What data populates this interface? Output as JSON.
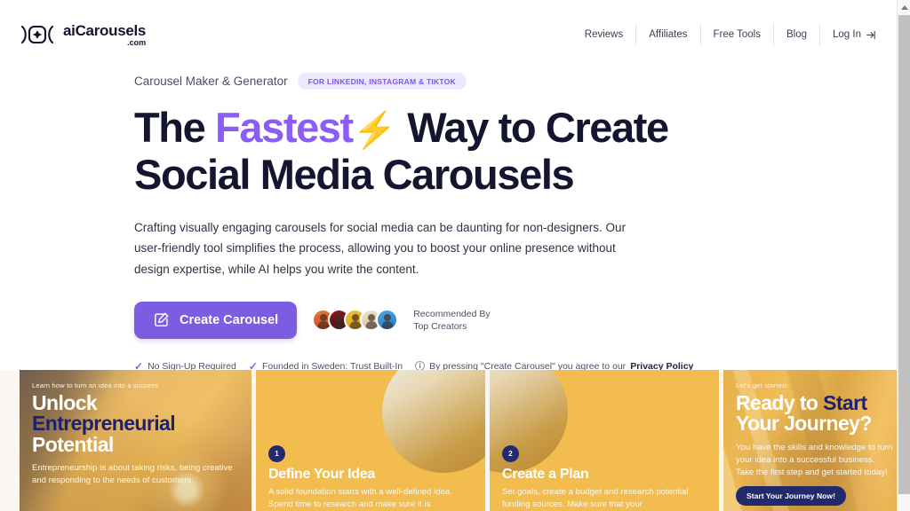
{
  "brand": {
    "logo_icon": "bracket-diamond-logo-icon",
    "name": "aiCarousels",
    "domain_suffix": ".com"
  },
  "nav": {
    "items": [
      {
        "label": "Reviews"
      },
      {
        "label": "Affiliates"
      },
      {
        "label": "Free Tools"
      },
      {
        "label": "Blog"
      }
    ],
    "login": {
      "label": "Log In",
      "icon": "login-arrow-icon"
    }
  },
  "hero": {
    "eyebrow": "Carousel Maker & Generator",
    "badge": "FOR LINKEDIN, INSTAGRAM & TIKTOK",
    "headline": {
      "part1": "The ",
      "accent": "Fastest",
      "emoji": "⚡",
      "part2": " Way to Create",
      "line2": "Social Media Carousels"
    },
    "subtext": "Crafting visually engaging carousels for social media can be daunting for non-designers. Our user-friendly tool simplifies the process, allowing you to boost your online presence without design expertise, while AI helps you write the content.",
    "cta": {
      "label": "Create Carousel",
      "icon": "edit-square-icon"
    },
    "recommended": {
      "line1": "Recommended By",
      "line2": "Top Creators"
    },
    "trust": {
      "item1": "No Sign-Up Required",
      "item2": "Founded in Sweden: Trust Built-In",
      "disclaimer": "By pressing \"Create Carousel\" you agree to our ",
      "privacy_link": "Privacy Policy"
    }
  },
  "carousel": {
    "cards": [
      {
        "kicker": "Learn how to turn an idea into a success",
        "title_white": "Unlock ",
        "title_navy": "Entrepreneurial",
        "title_line2": "Potential",
        "body": "Entrepreneurship is about taking risks, being creative and responding to the needs of customers."
      },
      {
        "badge": "1",
        "title": "Define Your Idea",
        "body": "A solid foundation starts with a well-defined idea. Spend time to research and make sure it is"
      },
      {
        "badge": "2",
        "title": "Create a Plan",
        "body": "Set goals, create a budget and research potential funding sources. Make sure that your"
      },
      {
        "kicker": "Let's get started!",
        "title_white": "Ready to ",
        "title_navy": "Start",
        "title_line2": "Your Journey?",
        "body": "You have the skills and knowledge to turn your idea into a successful business. Take the first step and get started today!",
        "button": "Start Your Journey Now!"
      }
    ]
  },
  "colors": {
    "accent_purple": "#7c5ce0",
    "headline_navy": "#14152e",
    "card_amber": "#f2bc4f",
    "card_navy": "#222a6e",
    "pill_bg": "#ece8fd"
  }
}
